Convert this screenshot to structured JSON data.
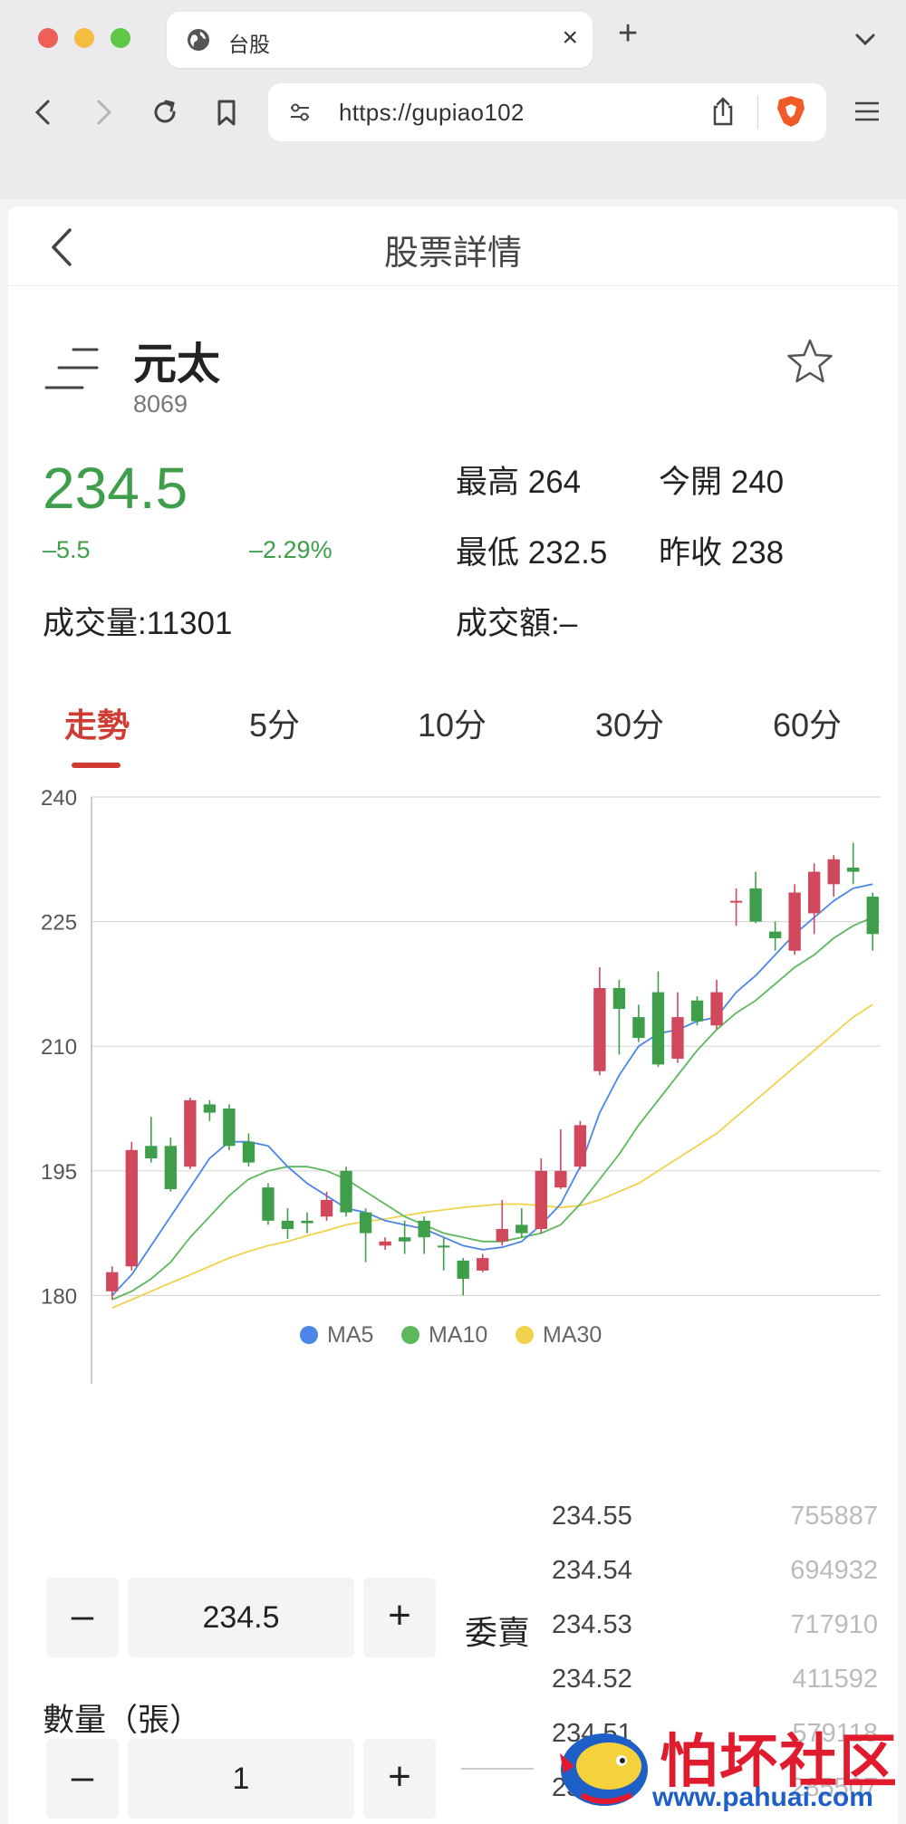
{
  "browser": {
    "tab_title": "台股",
    "url": "https://gupiao102"
  },
  "page": {
    "title": "股票詳情"
  },
  "stock": {
    "name": "元太",
    "code": "8069",
    "price": "234.5",
    "change": "–5.5",
    "change_pct": "–2.29%",
    "high": "最高 264",
    "open": "今開 240",
    "low": "最低 232.5",
    "prev_close": "昨收 238",
    "volume": "成交量:11301",
    "amount": "成交額:–",
    "color_down": "#3f9e4a",
    "color_up": "#d1475c"
  },
  "period_tabs": [
    "走勢",
    "5分",
    "10分",
    "30分",
    "60分"
  ],
  "chart_data": {
    "type": "candlestick",
    "ylim": [
      165,
      240
    ],
    "yticks": [
      "240",
      "225",
      "210",
      "195",
      "180",
      "165"
    ],
    "candles": [
      {
        "o": 180.5,
        "c": 182.8,
        "h": 183.5,
        "l": 179.5
      },
      {
        "o": 183.5,
        "c": 197.5,
        "h": 198.5,
        "l": 183.0
      },
      {
        "o": 198.0,
        "c": 196.5,
        "h": 201.5,
        "l": 196.0
      },
      {
        "o": 198.0,
        "c": 192.8,
        "h": 199.0,
        "l": 192.5
      },
      {
        "o": 195.5,
        "c": 203.5,
        "h": 203.8,
        "l": 195.2
      },
      {
        "o": 203.0,
        "c": 202.0,
        "h": 203.5,
        "l": 201.0
      },
      {
        "o": 202.5,
        "c": 198.0,
        "h": 203.0,
        "l": 197.5
      },
      {
        "o": 198.5,
        "c": 196.0,
        "h": 199.5,
        "l": 195.5
      },
      {
        "o": 193.0,
        "c": 189.0,
        "h": 193.5,
        "l": 188.5
      },
      {
        "o": 189.0,
        "c": 188.0,
        "h": 190.5,
        "l": 186.8
      },
      {
        "o": 189.0,
        "c": 188.7,
        "h": 190.0,
        "l": 187.5
      },
      {
        "o": 189.5,
        "c": 191.5,
        "h": 192.5,
        "l": 189.0
      },
      {
        "o": 195.0,
        "c": 190.0,
        "h": 195.5,
        "l": 189.5
      },
      {
        "o": 190.0,
        "c": 187.5,
        "h": 190.5,
        "l": 184.0
      },
      {
        "o": 186.0,
        "c": 186.5,
        "h": 187.0,
        "l": 185.5
      },
      {
        "o": 187.0,
        "c": 186.5,
        "h": 189.0,
        "l": 185.0
      },
      {
        "o": 189.0,
        "c": 187.0,
        "h": 189.5,
        "l": 185.0
      },
      {
        "o": 186.0,
        "c": 185.8,
        "h": 187.0,
        "l": 183.0
      },
      {
        "o": 184.2,
        "c": 182.0,
        "h": 184.5,
        "l": 180.0
      },
      {
        "o": 183.0,
        "c": 184.5,
        "h": 185.0,
        "l": 182.8
      },
      {
        "o": 186.5,
        "c": 188.0,
        "h": 191.5,
        "l": 186.0
      },
      {
        "o": 188.5,
        "c": 187.5,
        "h": 190.5,
        "l": 187.0
      },
      {
        "o": 188.0,
        "c": 195.0,
        "h": 196.5,
        "l": 187.5
      },
      {
        "o": 193.0,
        "c": 195.0,
        "h": 200.0,
        "l": 192.8
      },
      {
        "o": 195.5,
        "c": 200.5,
        "h": 201.0,
        "l": 195.2
      },
      {
        "o": 207.0,
        "c": 217.0,
        "h": 219.5,
        "l": 206.5
      },
      {
        "o": 217.0,
        "c": 214.5,
        "h": 218.0,
        "l": 209.0
      },
      {
        "o": 213.5,
        "c": 211.0,
        "h": 215.0,
        "l": 210.5
      },
      {
        "o": 216.5,
        "c": 207.8,
        "h": 219.0,
        "l": 207.5
      },
      {
        "o": 208.5,
        "c": 213.5,
        "h": 216.5,
        "l": 208.0
      },
      {
        "o": 215.5,
        "c": 213.0,
        "h": 216.0,
        "l": 212.5
      },
      {
        "o": 212.5,
        "c": 216.5,
        "h": 218.0,
        "l": 212.0
      },
      {
        "o": 227.5,
        "c": 227.5,
        "h": 229.0,
        "l": 224.5
      },
      {
        "o": 229.0,
        "c": 225.0,
        "h": 231.0,
        "l": 224.8
      },
      {
        "o": 223.8,
        "c": 223.0,
        "h": 225.0,
        "l": 221.5
      },
      {
        "o": 221.5,
        "c": 228.5,
        "h": 229.5,
        "l": 221.0
      },
      {
        "o": 226.0,
        "c": 231.0,
        "h": 232.0,
        "l": 223.5
      },
      {
        "o": 229.5,
        "c": 232.5,
        "h": 233.0,
        "l": 228.0
      },
      {
        "o": 231.5,
        "c": 231.0,
        "h": 234.5,
        "l": 229.5
      },
      {
        "o": 228.0,
        "c": 223.5,
        "h": 228.5,
        "l": 221.5
      }
    ],
    "ma5": [
      180,
      182.5,
      186,
      189.5,
      193,
      196.5,
      198.5,
      198.5,
      198,
      195.5,
      193.5,
      192,
      190.5,
      190,
      189,
      188.5,
      188,
      187,
      186,
      185.5,
      185.8,
      186.5,
      188.5,
      191,
      195.5,
      202,
      206.5,
      210,
      211.5,
      212,
      213,
      213.5,
      216.5,
      218.5,
      221,
      223.5,
      225.5,
      227.5,
      229,
      229.5
    ],
    "ma10": [
      179.5,
      180.5,
      182,
      184,
      187,
      189.5,
      192,
      194,
      195,
      195.5,
      195.5,
      195,
      194,
      192.5,
      191,
      189.5,
      188.5,
      187.5,
      187,
      186.5,
      186.5,
      187,
      187.5,
      188.5,
      191,
      194,
      197,
      200.5,
      203.5,
      206.5,
      209.5,
      212,
      214,
      215.5,
      217.5,
      219.5,
      221,
      223,
      224.5,
      225.5
    ],
    "ma30": [
      178.5,
      179.5,
      180.5,
      181.5,
      182.5,
      183.5,
      184.5,
      185.3,
      186,
      186.5,
      187.2,
      187.8,
      188.5,
      188.9,
      189.2,
      189.6,
      190,
      190.3,
      190.6,
      190.8,
      191,
      191,
      190.8,
      190.6,
      190.8,
      191.5,
      192.5,
      193.5,
      195,
      196.5,
      198,
      199.5,
      201.5,
      203.5,
      205.5,
      207.5,
      209.5,
      211.5,
      213.5,
      215
    ]
  },
  "legend": [
    {
      "label": "MA5",
      "color": "#4a86e8"
    },
    {
      "label": "MA10",
      "color": "#5cb85c"
    },
    {
      "label": "MA30",
      "color": "#f0d24d"
    }
  ],
  "order": {
    "price_value": "234.5",
    "minus": "–",
    "plus": "+",
    "qty_label": "數量（張）",
    "qty_value": "1",
    "ask_label": "委賣",
    "asks": [
      {
        "price": "234.55",
        "vol": "755887"
      },
      {
        "price": "234.54",
        "vol": "694932"
      },
      {
        "price": "234.53",
        "vol": "717910"
      },
      {
        "price": "234.52",
        "vol": "411592"
      },
      {
        "price": "234.51",
        "vol": "579118"
      },
      {
        "price": "234.50",
        "vol": "285507"
      }
    ]
  },
  "watermark": {
    "text": "怕坏社区",
    "url": "www.pahuai.com"
  }
}
